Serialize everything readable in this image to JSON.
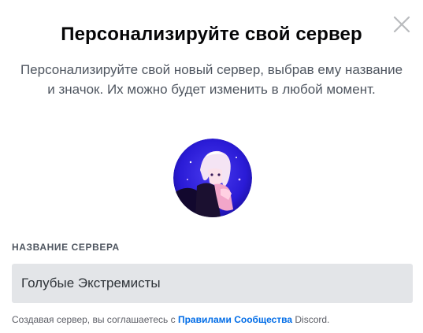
{
  "modal": {
    "title": "Персонализируйте свой сервер",
    "subtitle": "Персонализируйте свой новый сервер, выбрав ему название и значок. Их можно будет изменить в любой момент.",
    "close_icon": "close-icon"
  },
  "server_icon": {
    "icon": "server-avatar-image"
  },
  "server_name": {
    "label": "НАЗВАНИЕ СЕРВЕРА",
    "value": "Голубые Экстремисты"
  },
  "terms": {
    "prefix": "Создавая сервер, вы соглашаетесь с ",
    "link": "Правилами Сообщества",
    "suffix": " Discord."
  },
  "colors": {
    "link": "#006ce7",
    "input_bg": "#e3e5e8",
    "muted_text": "#4f5660"
  }
}
